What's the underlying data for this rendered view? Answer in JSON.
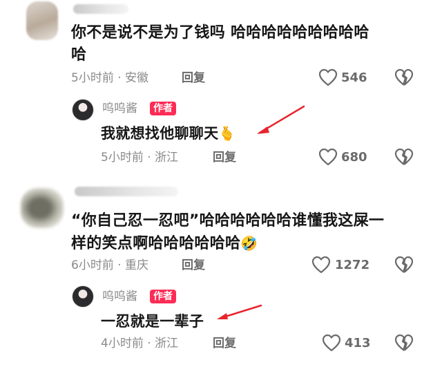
{
  "comments": [
    {
      "text_line1": "你不是说不是为了钱吗 哈哈哈哈哈哈哈哈哈",
      "text_line2": "哈",
      "time_location": "5小时前 · 安徽",
      "reply_label": "回复",
      "like_count": "546",
      "reply": {
        "author": "呜呜酱",
        "badge": "作者",
        "text": "我就想找他聊聊天",
        "emoji": "🫰",
        "time_location": "5小时前 · 浙江",
        "reply_label": "回复",
        "like_count": "680"
      }
    },
    {
      "text_line1": "“你自己忍一忍吧”哈哈哈哈哈哈谁懂我这屎一",
      "text_line2": "样的笑点啊哈哈哈哈哈哈",
      "emoji": "🤣",
      "time_location": "6小时前 · 重庆",
      "reply_label": "回复",
      "like_count": "1272",
      "reply": {
        "author": "呜呜酱",
        "badge": "作者",
        "text": "一忍就是一辈子",
        "time_location": "4小时前 · 浙江",
        "reply_label": "回复",
        "like_count": "413"
      }
    }
  ],
  "colors": {
    "badge": "#fe2c55",
    "arrow": "#e8242d",
    "text": "#161616",
    "meta": "#8a8a8a"
  }
}
